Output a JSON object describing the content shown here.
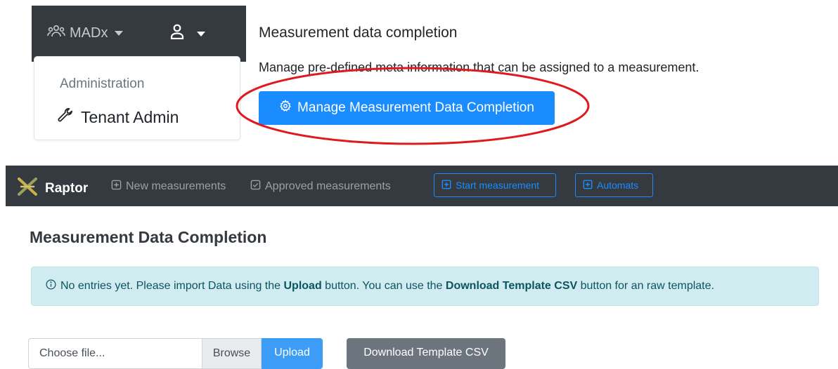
{
  "top_nav": {
    "team_label": "MADx",
    "team_icon": "users-icon",
    "user_icon": "user-icon"
  },
  "admin_menu": {
    "header": "Administration",
    "items": [
      {
        "label": "Tenant Admin",
        "icon": "wrench-icon"
      }
    ]
  },
  "settings_section": {
    "title": "Measurement data completion",
    "description": "Manage pre-defined meta information that can be assigned to a measurement.",
    "button_label": "Manage Measurement Data Completion",
    "button_icon": "gear-icon",
    "highlight_color": "#e0191f"
  },
  "raptor_nav": {
    "brand": "Raptor",
    "links": [
      {
        "label": "New measurements",
        "icon": "plus-square-icon"
      },
      {
        "label": "Approved measurements",
        "icon": "check-square-icon"
      }
    ],
    "buttons": [
      {
        "label": "Start measurement",
        "icon": "plus-square-icon"
      },
      {
        "label": "Automats",
        "icon": "plus-square-icon"
      }
    ]
  },
  "page": {
    "title": "Measurement Data Completion",
    "alert": {
      "prefix": "No entries yet. Please import Data using the",
      "upload_word": "Upload",
      "middle": "button. You can use the",
      "template_word": "Download Template CSV",
      "suffix": "button for an raw template."
    },
    "file_input": {
      "placeholder": "Choose file...",
      "browse_label": "Browse"
    },
    "upload_label": "Upload",
    "download_label": "Download Template CSV"
  },
  "colors": {
    "navbar": "#343a40",
    "primary": "#1a8cff",
    "info_bg": "#d1ecf1",
    "info_text": "#0c5460",
    "secondary": "#6c757d"
  }
}
